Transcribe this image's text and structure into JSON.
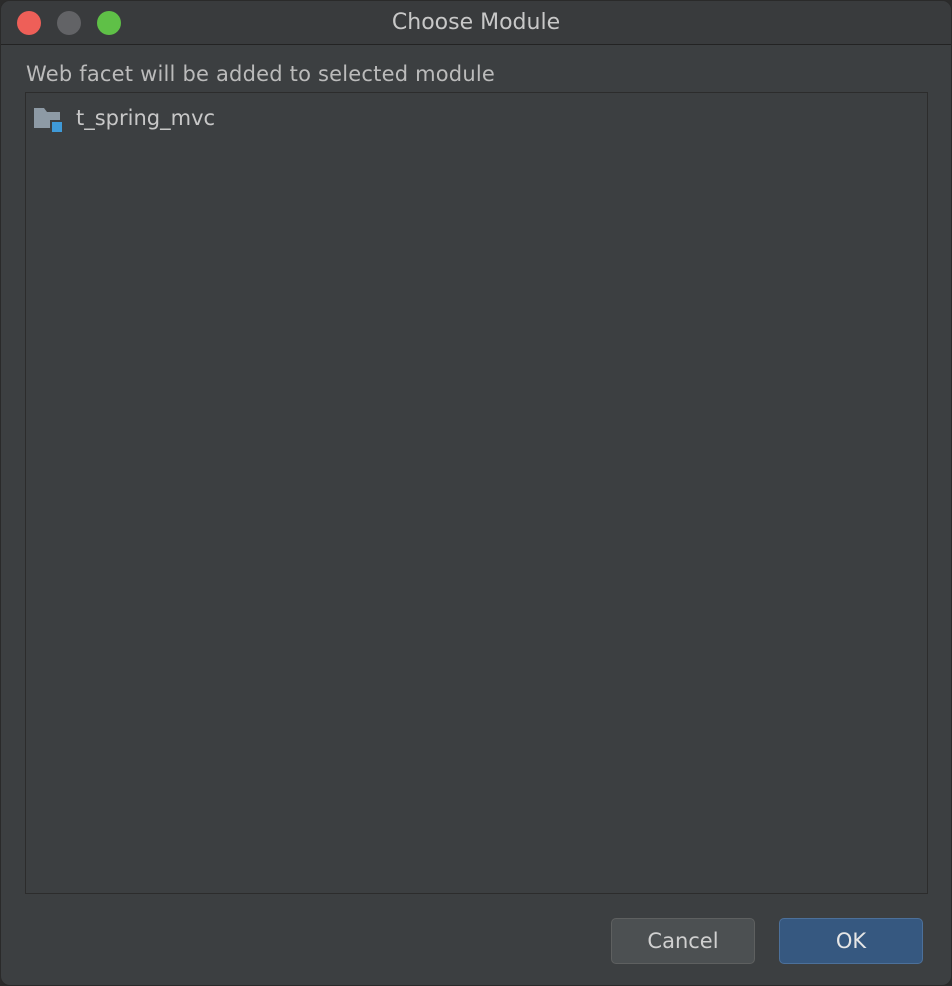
{
  "window": {
    "title": "Choose Module"
  },
  "traffic_lights": {
    "close_color": "#ee5f58",
    "minimize_color": "#626366",
    "zoom_color": "#5fc047"
  },
  "prompt_text": "Web facet will be added to selected module",
  "modules": [
    {
      "name": "t_spring_mvc",
      "icon": "module-folder-icon",
      "selected": false
    }
  ],
  "buttons": {
    "cancel_label": "Cancel",
    "ok_label": "OK"
  },
  "colors": {
    "folder_gray": "#8d9aa5",
    "module_badge": "#3f9ad8",
    "ok_button": "#365880"
  }
}
